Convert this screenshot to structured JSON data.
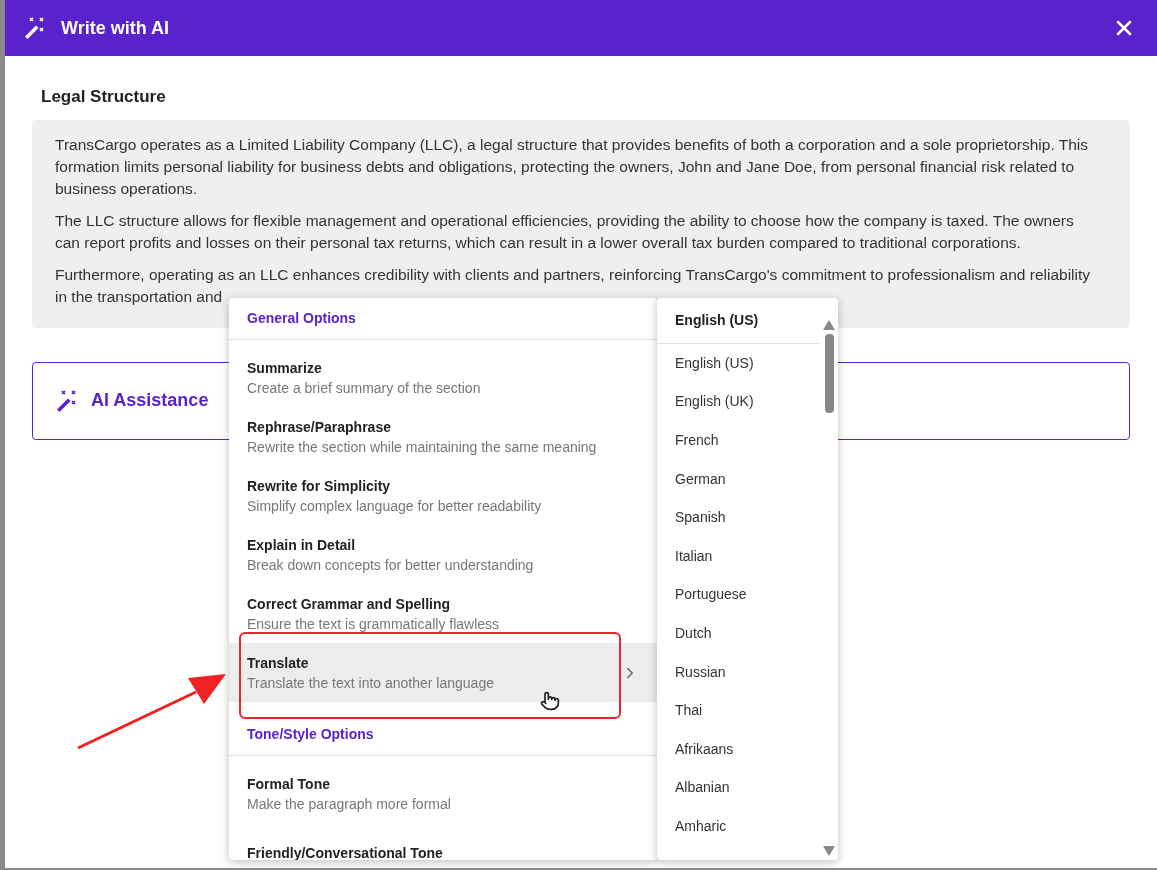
{
  "dialog": {
    "title": "Write with AI"
  },
  "section": {
    "title": "Legal Structure",
    "paragraphs": [
      "TransCargo operates as a Limited Liability Company (LLC), a legal structure that provides benefits of both a corporation and a sole proprietorship. This formation limits personal liability for business debts and obligations, protecting the owners, John and Jane Doe, from personal financial risk related to business operations.",
      "The LLC structure allows for flexible management and operational efficiencies, providing the ability to choose how the company is taxed. The owners can report profits and losses on their personal tax returns, which can result in a lower overall tax burden compared to traditional corporations.",
      "Furthermore, operating as an LLC enhances credibility with clients and partners, reinforcing TransCargo's commitment to professionalism and reliability in the transportation and"
    ]
  },
  "ai_assistance": {
    "label": "AI Assistance"
  },
  "menu": {
    "groups": [
      {
        "title": "General Options",
        "items": [
          {
            "title": "Summarize",
            "description": "Create a brief summary of the section",
            "selected": false,
            "has_submenu": false
          },
          {
            "title": "Rephrase/Paraphrase",
            "description": "Rewrite the section while maintaining the same meaning",
            "selected": false,
            "has_submenu": false
          },
          {
            "title": "Rewrite for Simplicity",
            "description": "Simplify complex language for better readability",
            "selected": false,
            "has_submenu": false
          },
          {
            "title": "Explain in Detail",
            "description": "Break down concepts for better understanding",
            "selected": false,
            "has_submenu": false
          },
          {
            "title": "Correct Grammar and Spelling",
            "description": "Ensure the text is grammatically flawless",
            "selected": false,
            "has_submenu": false
          },
          {
            "title": "Translate",
            "description": "Translate the text into another language",
            "selected": true,
            "has_submenu": true
          }
        ]
      },
      {
        "title": "Tone/Style Options",
        "items": [
          {
            "title": "Formal Tone",
            "description": "Make the paragraph more formal",
            "selected": false,
            "has_submenu": false
          },
          {
            "title": "Friendly/Conversational Tone",
            "selected": false,
            "has_submenu": false
          }
        ]
      }
    ]
  },
  "language_menu": {
    "current": "English (US)",
    "options": [
      "English (US)",
      "English (UK)",
      "French",
      "German",
      "Spanish",
      "Italian",
      "Portuguese",
      "Dutch",
      "Russian",
      "Thai",
      "Afrikaans",
      "Albanian",
      "Amharic"
    ]
  }
}
